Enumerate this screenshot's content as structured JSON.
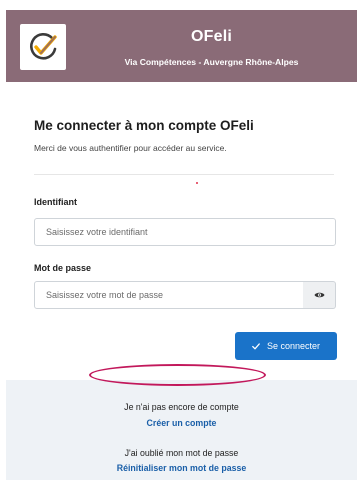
{
  "header": {
    "app_title": "OFeli",
    "app_subtitle": "Via Compétences - Auvergne Rhône-Alpes"
  },
  "login_form": {
    "title": "Me connecter à mon compte OFeli",
    "description": "Merci de vous authentifier pour accéder au service.",
    "identifier_label": "Identifiant",
    "identifier_placeholder": "Saisissez votre identifiant",
    "password_label": "Mot de passe",
    "password_placeholder": "Saisissez votre mot de passe",
    "submit_label": "Se connecter"
  },
  "footer": {
    "no_account_text": "Je n'ai pas encore de compte",
    "create_account_link": "Créer un compte",
    "forgot_password_text": "J'ai oublié mon mot de passe",
    "reset_password_link": "Réinitialiser mon mot de passe"
  },
  "colors": {
    "header_bg": "#8a6b77",
    "primary": "#1a73c9",
    "link": "#1a5fa8",
    "highlight": "#c2185b",
    "footer_bg": "#eef2f6"
  },
  "icons": {
    "logo": "ofeli-check-logo",
    "eye": "eye-icon",
    "check": "check-icon"
  }
}
